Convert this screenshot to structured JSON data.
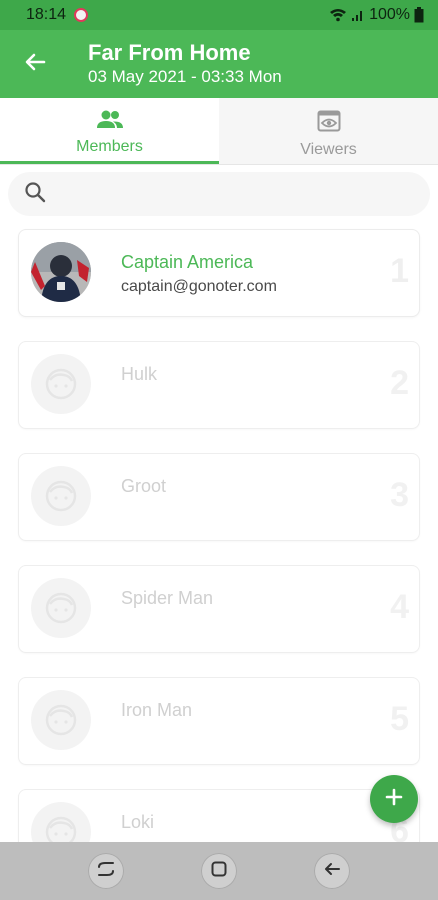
{
  "status_bar": {
    "time": "18:14",
    "battery": "100%"
  },
  "app_bar": {
    "title": "Far From Home",
    "subtitle": "03 May 2021 - 03:33 Mon"
  },
  "tabs": [
    {
      "label": "Members",
      "icon": "people-icon",
      "active": true
    },
    {
      "label": "Viewers",
      "icon": "eye-icon",
      "active": false
    }
  ],
  "search": {
    "placeholder": ""
  },
  "members": [
    {
      "name": "Captain America",
      "email": "captain@gonoter.com",
      "index": "1",
      "active": true
    },
    {
      "name": "Hulk",
      "email": "",
      "index": "2",
      "active": false
    },
    {
      "name": "Groot",
      "email": "",
      "index": "3",
      "active": false
    },
    {
      "name": "Spider Man",
      "email": "",
      "index": "4",
      "active": false
    },
    {
      "name": "Iron Man",
      "email": "",
      "index": "5",
      "active": false
    },
    {
      "name": "Loki",
      "email": "",
      "index": "6",
      "active": false
    }
  ],
  "colors": {
    "primary": "#4cb857",
    "status_bar": "#3ea84a",
    "fab": "#3ea84a"
  }
}
